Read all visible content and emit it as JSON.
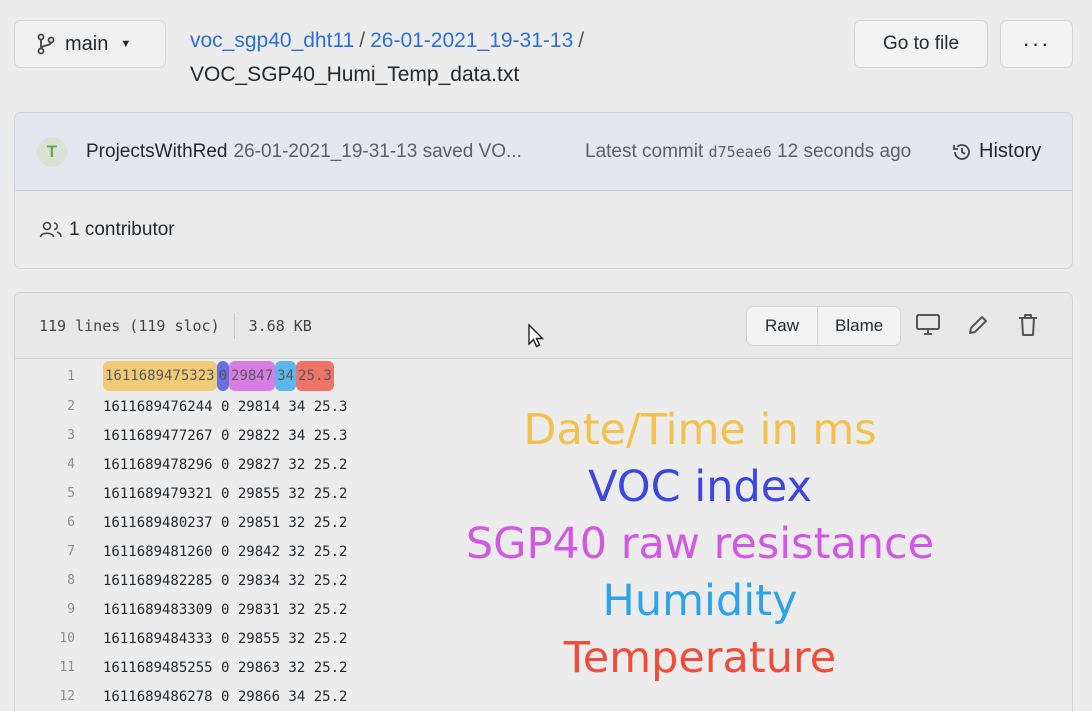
{
  "branch": {
    "name": "main",
    "icon": "git-branch-icon"
  },
  "breadcrumb": {
    "repo": "voc_sgp40_dht11",
    "folder": "26-01-2021_19-31-13",
    "separator": "/",
    "file": "VOC_SGP40_Humi_Temp_data.txt"
  },
  "toolbar": {
    "goto_label": "Go to file",
    "more_label": "···"
  },
  "commit": {
    "avatar_letter": "T",
    "author": "ProjectsWithRed",
    "message": "26-01-2021_19-31-13 saved VO...",
    "latest_label": "Latest commit",
    "sha": "d75eae6",
    "time": "12 seconds ago",
    "history_label": "History"
  },
  "contributors": {
    "text": "1 contributor"
  },
  "file_info": {
    "lines": "119 lines (119 sloc)",
    "size": "3.68 KB"
  },
  "file_actions": {
    "raw": "Raw",
    "blame": "Blame"
  },
  "colors": {
    "date": "#f2c14e",
    "voc": "#3b47e0",
    "raw": "#d158e0",
    "humidity": "#2ea3e8",
    "temperature": "#ef4d3c"
  },
  "lines": [
    {
      "n": "1",
      "text": "1611689475323 0 29847 34 25.3"
    },
    {
      "n": "2",
      "text": "1611689476244 0 29814 34 25.3"
    },
    {
      "n": "3",
      "text": "1611689477267 0 29822 34 25.3"
    },
    {
      "n": "4",
      "text": "1611689478296 0 29827 32 25.2"
    },
    {
      "n": "5",
      "text": "1611689479321 0 29855 32 25.2"
    },
    {
      "n": "6",
      "text": "1611689480237 0 29851 32 25.2"
    },
    {
      "n": "7",
      "text": "1611689481260 0 29842 32 25.2"
    },
    {
      "n": "8",
      "text": "1611689482285 0 29834 32 25.2"
    },
    {
      "n": "9",
      "text": "1611689483309 0 29831 32 25.2"
    },
    {
      "n": "10",
      "text": "1611689484333 0 29855 32 25.2"
    },
    {
      "n": "11",
      "text": "1611689485255 0 29863 32 25.2"
    },
    {
      "n": "12",
      "text": "1611689486278 0 29866 34 25.2"
    }
  ],
  "first_line_fields": [
    "1611689475323",
    "0",
    "29847",
    "34",
    "25.3"
  ],
  "legend": {
    "date": "Date/Time in ms",
    "voc": "VOC index",
    "raw": "SGP40 raw resistance",
    "humidity": "Humidity",
    "temperature": "Temperature"
  }
}
